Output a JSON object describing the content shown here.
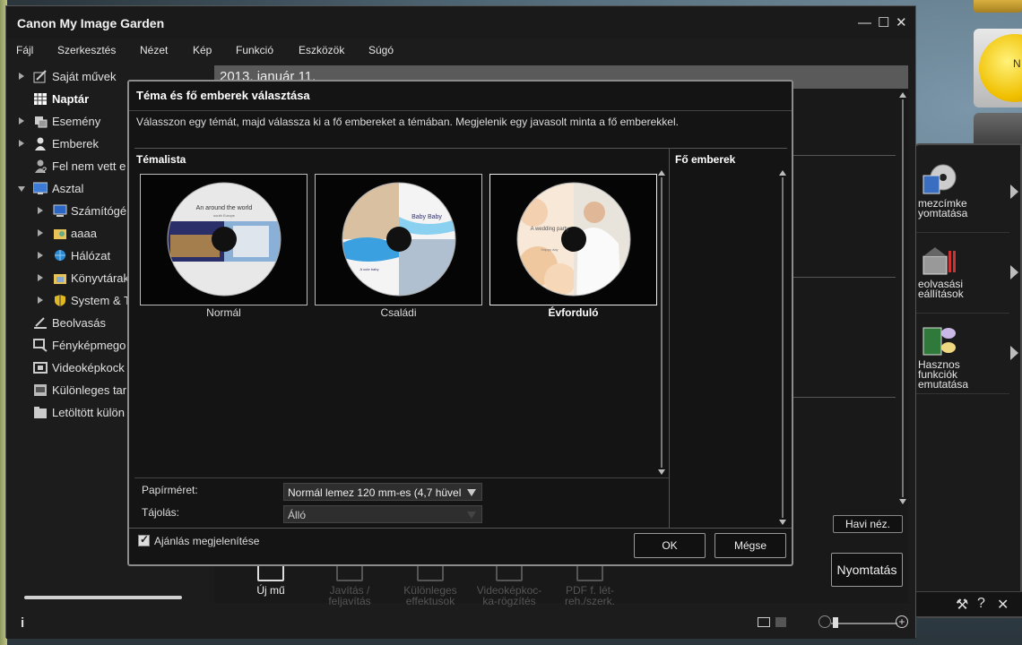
{
  "window": {
    "title": "Canon My Image Garden",
    "minimize_icon": "minimize-icon",
    "maximize_icon": "maximize-icon",
    "close_icon": "close-icon"
  },
  "menu": [
    "Fájl",
    "Szerkesztés",
    "Nézet",
    "Kép",
    "Funkció",
    "Eszközök",
    "Súgó"
  ],
  "sidebar": {
    "items": [
      {
        "label": "Saját művek",
        "icon": "works-icon",
        "expander": "right"
      },
      {
        "label": "Naptár",
        "icon": "calendar-icon",
        "expander": "none",
        "bold": true
      },
      {
        "label": "Esemény",
        "icon": "event-icon",
        "expander": "right"
      },
      {
        "label": "Emberek",
        "icon": "person-icon",
        "expander": "right"
      },
      {
        "label": "Fel nem vett e",
        "icon": "unregistered-person-icon",
        "expander": "none"
      },
      {
        "label": "Asztal",
        "icon": "desktop-icon",
        "expander": "down"
      },
      {
        "label": "Számítógé",
        "icon": "computer-icon",
        "expander": "right",
        "indent": true
      },
      {
        "label": "aaaa",
        "icon": "folder-user-icon",
        "expander": "right",
        "indent": true
      },
      {
        "label": "Hálózat",
        "icon": "network-icon",
        "expander": "right",
        "indent": true
      },
      {
        "label": "Könyvtárak",
        "icon": "libraries-icon",
        "expander": "right",
        "indent": true
      },
      {
        "label": "System & T",
        "icon": "shield-icon",
        "expander": "right",
        "indent": true
      },
      {
        "label": "Beolvasás",
        "icon": "scan-icon",
        "expander": "none"
      },
      {
        "label": "Fényképmego",
        "icon": "photo-share-icon",
        "expander": "none"
      },
      {
        "label": "Videoképkock",
        "icon": "video-frame-icon",
        "expander": "none"
      },
      {
        "label": "Különleges tar",
        "icon": "special-content-icon",
        "expander": "none"
      },
      {
        "label": "Letöltött külön",
        "icon": "downloaded-folder-icon",
        "expander": "none"
      }
    ]
  },
  "content": {
    "date": "2013. január 11.",
    "month_view_button": "Havi néz."
  },
  "toolbar": {
    "tools": [
      {
        "label": "Új mű",
        "active": true
      },
      {
        "label": "Javítás /\nfeljavítás",
        "active": false
      },
      {
        "label": "Különleges\neffektusok",
        "active": false
      },
      {
        "label": "Videoképkoc-\nka-rögzítés",
        "active": false
      },
      {
        "label": "PDF f. lét-\nreh./szerk.",
        "active": false
      }
    ],
    "print_button": "Nyomtatás"
  },
  "status": {
    "info_icon": "i"
  },
  "side_panel": {
    "items": [
      {
        "label": "mezcímke\nyomtatása",
        "icon": "disc-label-icon"
      },
      {
        "label": "eolvasási\neállítások",
        "icon": "scanner-settings-icon"
      },
      {
        "label": "Hasznos\nfunkciók\nemutatása",
        "icon": "useful-functions-icon"
      }
    ],
    "sun_label": "N"
  },
  "dialog": {
    "title": "Téma és fő emberek választása",
    "description": "Válasszon egy témát, majd válassza ki a fő embereket a témában. Megjelenik egy javasolt minta a fő emberekkel.",
    "theme_list_heading": "Témalista",
    "main_people_heading": "Fő emberek",
    "themes": [
      {
        "name": "Normál",
        "disc_text": "An around the world",
        "disc_subtext": "south Europe",
        "selected": false
      },
      {
        "name": "Családi",
        "disc_text": "Baby Baby",
        "disc_subtext": "A cute baby",
        "selected": false
      },
      {
        "name": "Évforduló",
        "disc_text": "A wedding party",
        "disc_subtext": "Happy day",
        "selected": true
      }
    ],
    "paper_size_label": "Papírméret:",
    "paper_size_value": "Normál lemez 120 mm-es (4,7 hüvel",
    "orientation_label": "Tájolás:",
    "orientation_value": "Álló",
    "show_recommendation_label": "Ajánlás megjelenítése",
    "show_recommendation_checked": true,
    "ok_button": "OK",
    "cancel_button": "Mégse"
  },
  "colors": {
    "window_bg": "#1c1c1c",
    "dialog_bg": "#141414",
    "dialog_border": "#8c8c8c",
    "text": "#e8e8e8",
    "date_bar": "#5a5a5a"
  }
}
